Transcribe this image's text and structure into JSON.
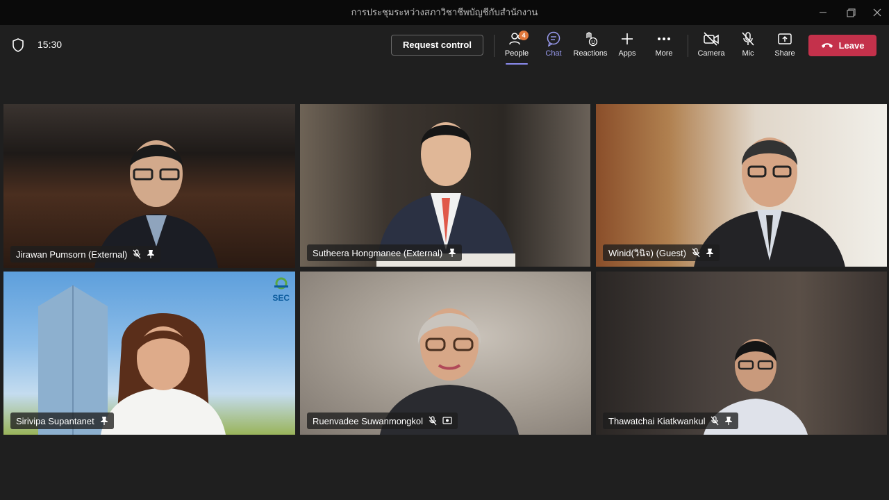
{
  "window": {
    "title": "การประชุมระหว่างสภาวิชาชีพบัญชีกับสำนักงาน"
  },
  "toolbar": {
    "time": "15:30",
    "request_control": "Request control",
    "people_label": "People",
    "people_badge": "4",
    "chat_label": "Chat",
    "reactions_label": "Reactions",
    "apps_label": "Apps",
    "more_label": "More",
    "camera_label": "Camera",
    "mic_label": "Mic",
    "share_label": "Share",
    "leave_label": "Leave"
  },
  "participants": [
    {
      "name": "Jirawan Pumsorn (External)"
    },
    {
      "name": "Sutheera Hongmanee (External)"
    },
    {
      "name": "Winid(วินิจ) (Guest)"
    },
    {
      "name": "Sirivipa Supantanet",
      "logo_text": "SEC"
    },
    {
      "name": "Ruenvadee Suwanmongkol"
    },
    {
      "name": "Thawatchai Kiatkwankul"
    }
  ],
  "colors": {
    "leave": "#c4314b",
    "accent": "#8b8cf0",
    "badge": "#e0773a"
  }
}
